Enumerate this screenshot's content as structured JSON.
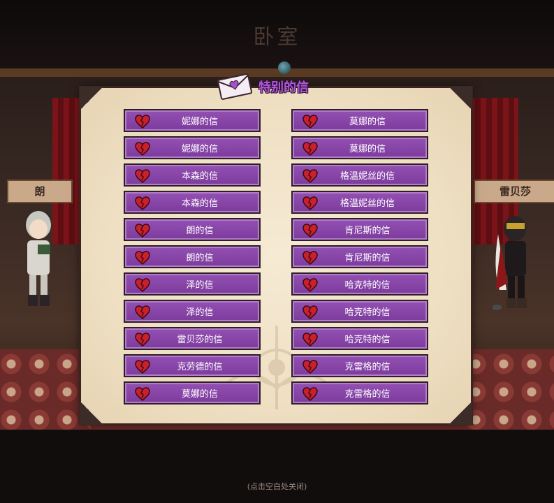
{
  "room_title": "卧室",
  "panel_title": "特别的信",
  "characters": {
    "left_name": "朗",
    "right_name": "雷贝莎"
  },
  "close_hint": "(点击空白处关闭)",
  "letters": [
    {
      "left": "妮娜的信",
      "right": "莫娜的信"
    },
    {
      "left": "妮娜的信",
      "right": "莫娜的信"
    },
    {
      "left": "本森的信",
      "right": "格温妮丝的信"
    },
    {
      "left": "本森的信",
      "right": "格温妮丝的信"
    },
    {
      "left": "朗的信",
      "right": "肯尼斯的信"
    },
    {
      "left": "朗的信",
      "right": "肯尼斯的信"
    },
    {
      "left": "泽的信",
      "right": "哈克特的信"
    },
    {
      "left": "泽的信",
      "right": "哈克特的信"
    },
    {
      "left": "雷贝莎的信",
      "right": "哈克特的信"
    },
    {
      "left": "克劳德的信",
      "right": "克雷格的信"
    },
    {
      "left": "莫娜的信",
      "right": "克雷格的信"
    }
  ],
  "icons": {
    "letter_icon": "broken-heart-icon",
    "header_icon": "heart-envelope-icon"
  },
  "colors": {
    "button": "#8a46aa",
    "title": "#b058d8",
    "paper": "#f2e4c8"
  }
}
